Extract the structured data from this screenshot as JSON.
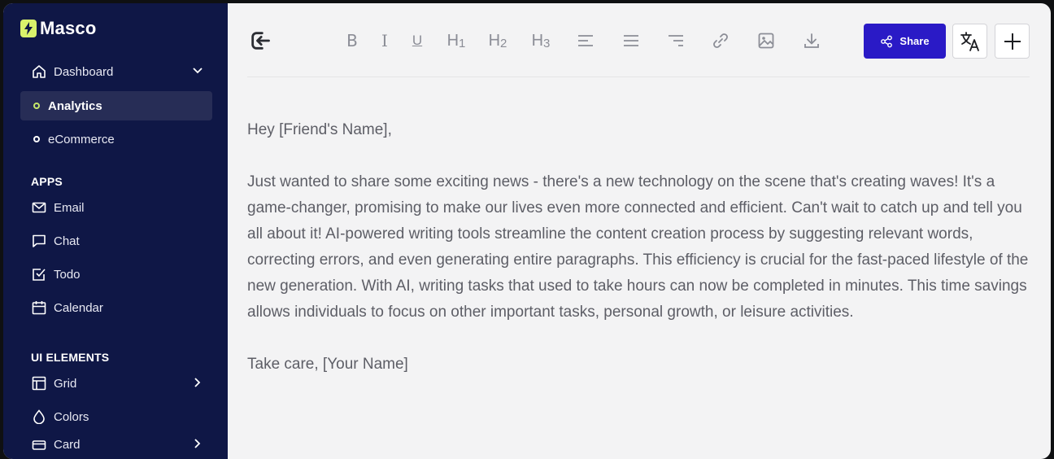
{
  "app": {
    "name": "Masco"
  },
  "sidebar": {
    "dashboard": "Dashboard",
    "analytics": "Analytics",
    "ecommerce": "eCommerce",
    "apps_title": "APPS",
    "email": "Email",
    "chat": "Chat",
    "todo": "Todo",
    "calendar": "Calendar",
    "ui_title": "UI ELEMENTS",
    "grid": "Grid",
    "colors": "Colors",
    "card": "Card"
  },
  "toolbar": {
    "bold": "B",
    "italic": "I",
    "underline": "U",
    "h1": "H1",
    "h2": "H2",
    "h3": "H3",
    "share_label": "Share"
  },
  "letter": {
    "greeting": "Hey [Friend's Name],",
    "body": "Just wanted to share some exciting news - there's a new technology on the scene that's creating waves! It's a game-changer, promising to make our lives even more connected and efficient. Can't wait to catch up and tell you all about it! AI-powered writing tools streamline the content creation process by suggesting relevant words, correcting errors, and even generating entire paragraphs. This efficiency is crucial for the fast-paced lifestyle of the new generation. With AI, writing tasks that used to take hours can now be completed in minutes. This time savings allows individuals to focus on other important tasks, personal growth, or leisure activities.",
    "signoff": "Take care, [Your Name]"
  },
  "colors": {
    "sidebar_bg": "#0f1746",
    "accent": "#2a1ac6",
    "logo": "#d9f26b",
    "active_dot": "#c6e86a"
  },
  "icons": [
    "lightning-icon",
    "home-icon",
    "chevron-down-icon",
    "mail-icon",
    "chat-icon",
    "checkbox-icon",
    "calendar-icon",
    "grid-icon",
    "drop-icon",
    "card-icon",
    "chevron-right-icon",
    "exit-icon",
    "align-left-icon",
    "align-center-icon",
    "align-right-icon",
    "link-icon",
    "image-icon",
    "download-icon",
    "share-icon",
    "translate-icon",
    "plus-icon"
  ]
}
